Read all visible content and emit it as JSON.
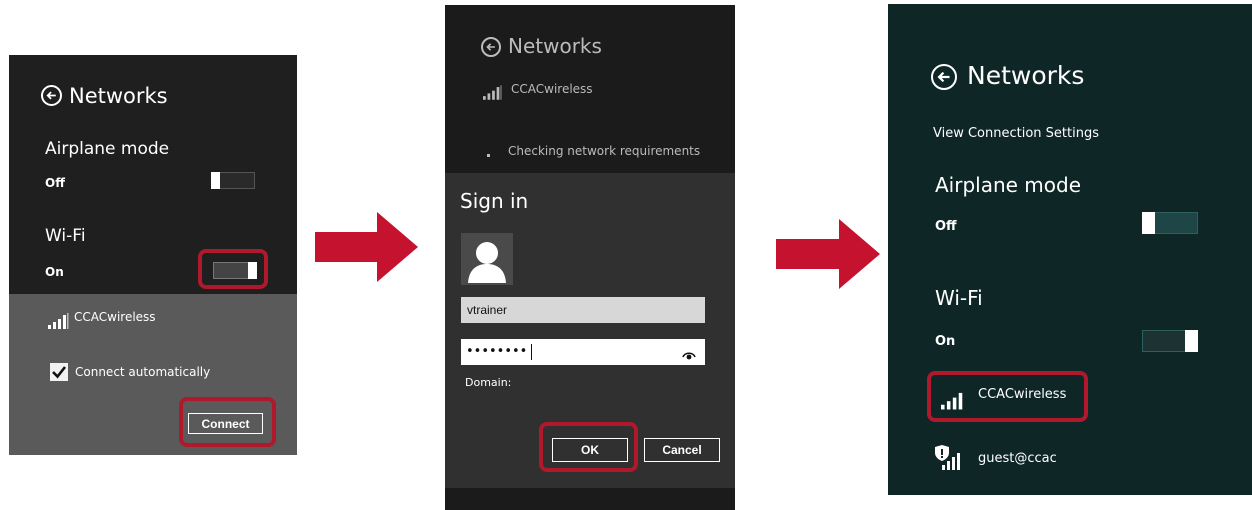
{
  "colors": {
    "highlight": "#b0182c",
    "arrow": "#c4122f",
    "panel1_bg": "#1f1f1f",
    "panel1_lower_bg": "#5a5a5a",
    "panel2_bg": "#1b1b1b",
    "panel2_dialog_bg": "#303030",
    "panel3_bg": "#0f2626"
  },
  "panel1": {
    "title": "Networks",
    "airplane_label": "Airplane mode",
    "airplane_state": "Off",
    "wifi_label": "Wi-Fi",
    "wifi_state": "On",
    "network_name": "CCACwireless",
    "connect_auto_label": "Connect automatically",
    "connect_button": "Connect"
  },
  "panel2": {
    "title": "Networks",
    "network_name": "CCACwireless",
    "status": "Checking network requirements",
    "signin_title": "Sign in",
    "username_value": "vtrainer",
    "password_value": "••••••••",
    "domain_label": "Domain:",
    "ok_button": "OK",
    "cancel_button": "Cancel"
  },
  "panel3": {
    "title": "Networks",
    "view_settings": "View Connection Settings",
    "airplane_label": "Airplane mode",
    "airplane_state": "Off",
    "wifi_label": "Wi-Fi",
    "wifi_state": "On",
    "network_1": "CCACwireless",
    "network_2": "guest@ccac"
  },
  "icons": {
    "back": "back-arrow-circle-icon",
    "signal": "wifi-signal-bars-icon",
    "user": "user-avatar-icon",
    "eye": "reveal-password-eye-icon",
    "check": "checkbox-checked-icon",
    "shield": "secured-network-shield-icon",
    "flow_arrow": "right-arrow-icon"
  }
}
